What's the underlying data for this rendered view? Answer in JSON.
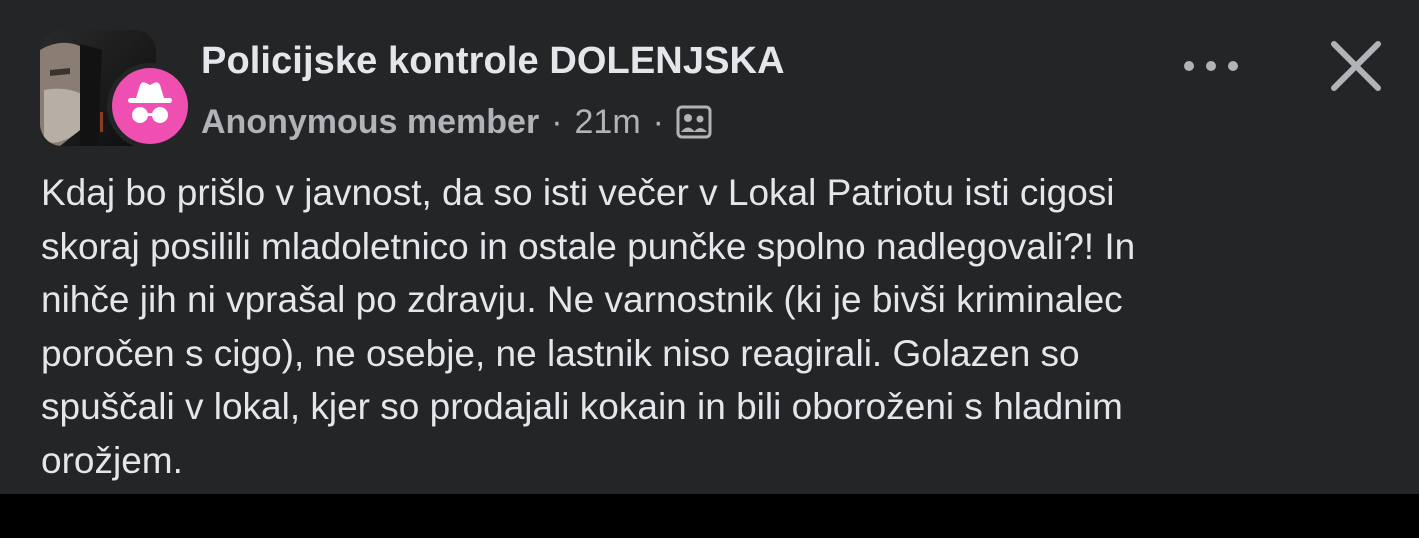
{
  "post": {
    "group_name": "Policijske kontrole DOLENJSKA",
    "author": "Anonymous member",
    "separator": "·",
    "time": "21m",
    "audience_icon": "group-members-icon",
    "more_icon": "more-options-icon",
    "close_icon": "close-icon",
    "group_photo": "group-cover-photo",
    "author_avatar_icon": "incognito-icon",
    "body": "Kdaj bo prišlo v javnost, da so isti večer v Lokal Patriotu isti cigosi\nskoraj posilili mladoletnico in ostale punčke spolno nadlegovali?! In\nnihče jih ni vprašal po zdravju. Ne varnostnik (ki je bivši kriminalec\nporočen s cigo), ne osebje, ne lastnik niso reagirali. Golazen so\nspuščali v lokal, kjer so prodajali kokain in bili oboroženi s hladnim\norožjem."
  },
  "colors": {
    "post_background": "#242526",
    "page_background": "#000000",
    "primary_text": "#e4e6eb",
    "secondary_text": "#b0b3b8",
    "anonymous_avatar": "#ee4fb0"
  }
}
